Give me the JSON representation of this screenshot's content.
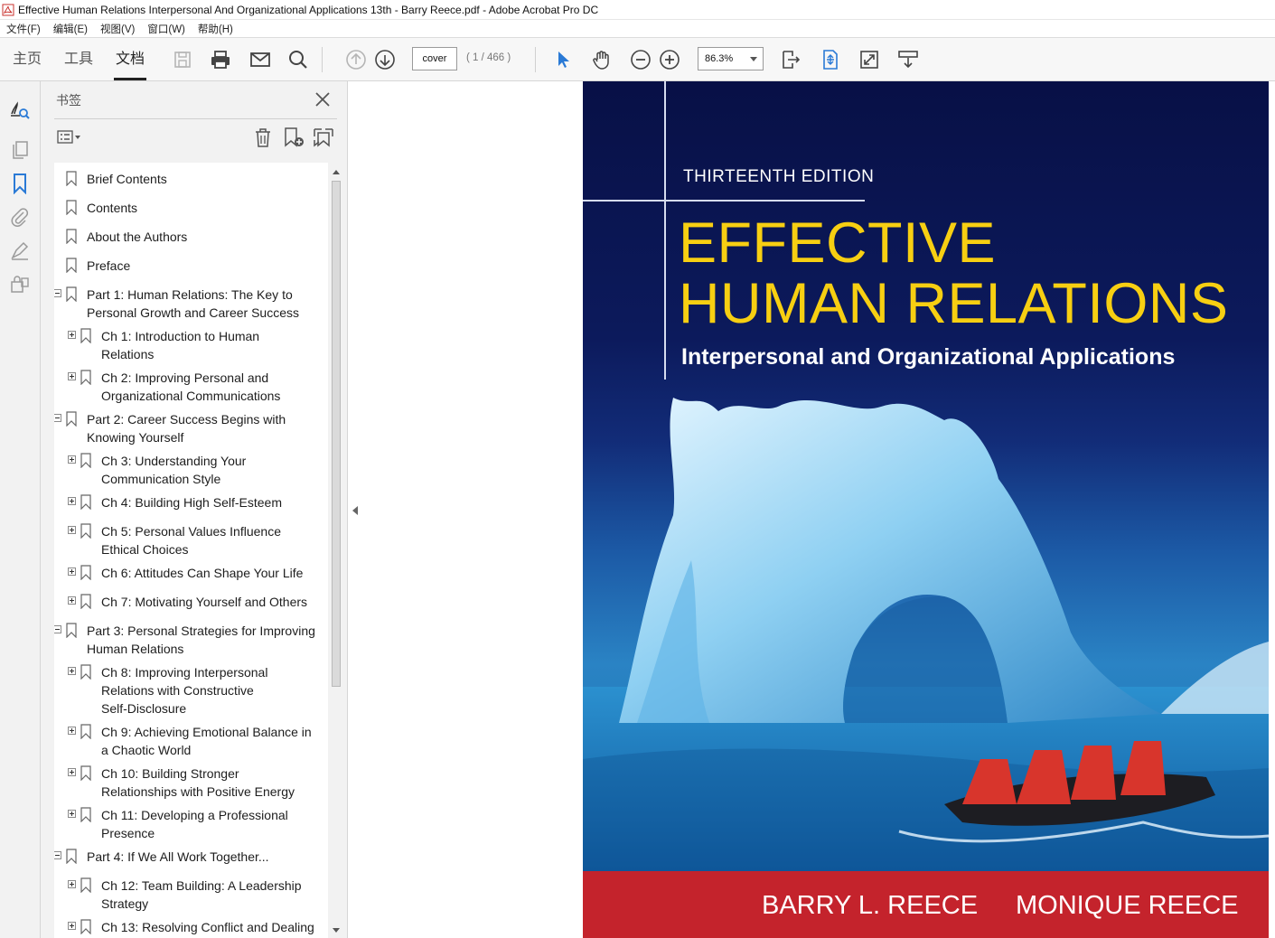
{
  "window": {
    "title": "Effective Human Relations Interpersonal And Organizational Applications 13th - Barry Reece.pdf - Adobe Acrobat Pro DC"
  },
  "menu": [
    "文件(F)",
    "编辑(E)",
    "视图(V)",
    "窗口(W)",
    "帮助(H)"
  ],
  "toolbar": {
    "tabs": [
      "主页",
      "工具",
      "文档"
    ],
    "active_tab": "文档",
    "page_input": "cover",
    "page_count": "( 1 / 466 )",
    "zoom": "86.3%",
    "icons": [
      "save-icon",
      "print-icon",
      "email-icon",
      "search-icon",
      "page-up-icon",
      "page-down-icon",
      "select-cursor-icon",
      "hand-tool-icon",
      "zoom-out-icon",
      "zoom-in-icon",
      "fit-width-icon",
      "fit-page-icon",
      "fullscreen-icon",
      "read-mode-icon"
    ]
  },
  "rail": {
    "icons": [
      "find-text-icon",
      "pages-icon",
      "bookmarks-icon",
      "attachments-icon",
      "signature-icon",
      "security-icon"
    ]
  },
  "bookmarks": {
    "title": "书签",
    "items": [
      {
        "label": "Brief Contents",
        "level": 0,
        "expander": "none"
      },
      {
        "label": "Contents",
        "level": 0,
        "expander": "none"
      },
      {
        "label": "About the Authors",
        "level": 0,
        "expander": "none"
      },
      {
        "label": "Preface",
        "level": 0,
        "expander": "none"
      },
      {
        "label": "Part 1: Human Relations: The Key to",
        "label2": "Personal Growth and Career Success",
        "level": 0,
        "expander": "minus"
      },
      {
        "label": "Ch 1: Introduction to Human",
        "label2": "Relations",
        "level": 1,
        "expander": "plus"
      },
      {
        "label": "Ch 2: Improving Personal and",
        "label2": "Organizational Communications",
        "level": 1,
        "expander": "plus"
      },
      {
        "label": "Part 2: Career Success Begins with",
        "label2": "Knowing Yourself",
        "level": 0,
        "expander": "minus"
      },
      {
        "label": "Ch 3: Understanding Your",
        "label2": "Communication Style",
        "level": 1,
        "expander": "plus"
      },
      {
        "label": "Ch 4: Building High Self-Esteem",
        "level": 1,
        "expander": "plus"
      },
      {
        "label": "Ch 5: Personal Values Influence",
        "label2": "Ethical Choices",
        "level": 1,
        "expander": "plus"
      },
      {
        "label": "Ch 6: Attitudes Can Shape Your Life",
        "level": 1,
        "expander": "plus"
      },
      {
        "label": "Ch 7: Motivating Yourself and Others",
        "level": 1,
        "expander": "plus"
      },
      {
        "label": "Part 3: Personal Strategies for Improving",
        "label2": "Human Relations",
        "level": 0,
        "expander": "minus"
      },
      {
        "label": "Ch 8: Improving Interpersonal",
        "label2": "Relations with Constructive",
        "label3": "Self-Disclosure",
        "level": 1,
        "expander": "plus"
      },
      {
        "label": "Ch 9: Achieving Emotional Balance in",
        "label2": "a Chaotic World",
        "level": 1,
        "expander": "plus"
      },
      {
        "label": "Ch 10: Building Stronger",
        "label2": "Relationships with Positive Energy",
        "level": 1,
        "expander": "plus"
      },
      {
        "label": "Ch 11: Developing a Professional",
        "label2": "Presence",
        "level": 1,
        "expander": "plus"
      },
      {
        "label": "Part 4: If We All Work Together...",
        "level": 0,
        "expander": "minus"
      },
      {
        "label": "Ch 12: Team Building: A Leadership",
        "label2": "Strategy",
        "level": 1,
        "expander": "plus"
      },
      {
        "label": "Ch 13: Resolving Conflict and Dealing",
        "level": 1,
        "expander": "plus"
      }
    ]
  },
  "cover": {
    "edition": "THIRTEENTH EDITION",
    "title_line1": "EFFECTIVE",
    "title_line2": "HUMAN RELATIONS",
    "subtitle": "Interpersonal and Organizational Applications",
    "author1": "BARRY L. REECE",
    "author2": "MONIQUE REECE",
    "colors": {
      "navy": "#0b1552",
      "yellow": "#f7cf12",
      "red_band": "#c4232c"
    }
  }
}
